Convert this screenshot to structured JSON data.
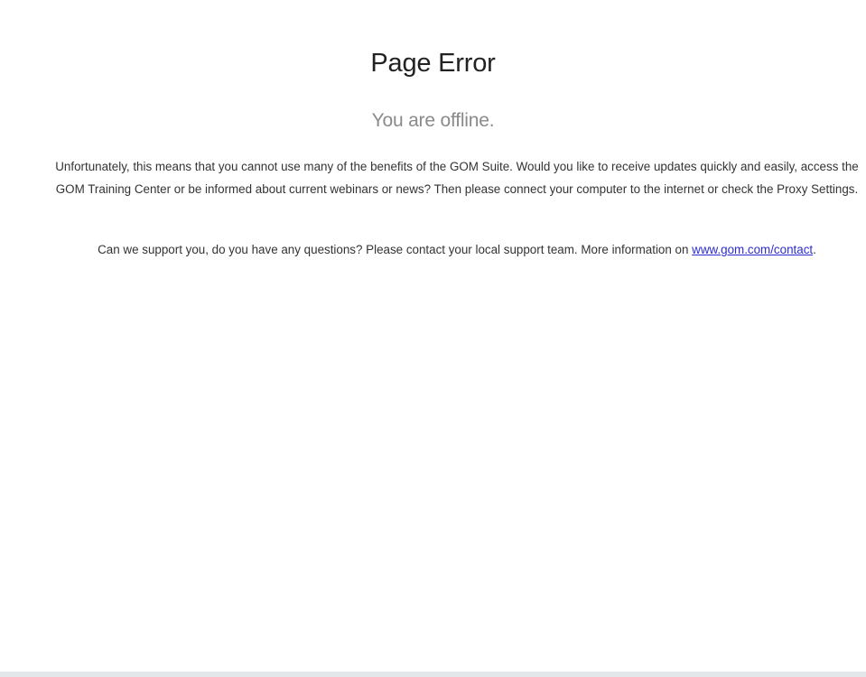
{
  "page": {
    "title": "Page Error",
    "subtitle": "You are offline.",
    "message": "Unfortunately, this means that you cannot use many of the benefits of the GOM Suite. Would you like to receive updates quickly and easily, access the GOM Training Center or be informed about current webinars or news? Then please connect your computer to the internet or check the Proxy Settings.",
    "support_prefix": "Can we support you, do you have any questions? Please contact your local support team. More information on ",
    "support_link": "www.gom.com/contact",
    "support_suffix": "."
  },
  "colors": {
    "link": "#2c2ccf",
    "subtitle": "#8a8a8a",
    "bottom_bar": "#e4e7ea"
  }
}
